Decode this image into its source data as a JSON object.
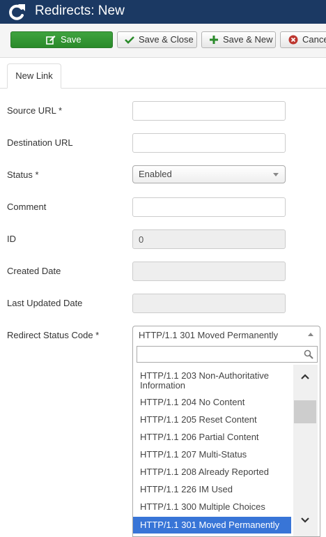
{
  "header": {
    "title": "Redirects: New"
  },
  "toolbar": {
    "save": "Save",
    "save_close": "Save & Close",
    "save_new": "Save & New",
    "cancel": "Cancel"
  },
  "tabs": [
    {
      "label": "New Link"
    }
  ],
  "form": {
    "source_url": {
      "label": "Source URL *",
      "value": ""
    },
    "destination_url": {
      "label": "Destination URL",
      "value": ""
    },
    "status": {
      "label": "Status *",
      "value": "Enabled"
    },
    "comment": {
      "label": "Comment",
      "value": ""
    },
    "id": {
      "label": "ID",
      "value": "0"
    },
    "created_date": {
      "label": "Created Date",
      "value": ""
    },
    "last_updated_date": {
      "label": "Last Updated Date",
      "value": ""
    },
    "redirect_status_code": {
      "label": "Redirect Status Code *",
      "value": "HTTP/1.1 301 Moved Permanently",
      "search_value": "",
      "options": [
        "HTTP/1.1 203 Non-Authoritative Information",
        "HTTP/1.1 204 No Content",
        "HTTP/1.1 205 Reset Content",
        "HTTP/1.1 206 Partial Content",
        "HTTP/1.1 207 Multi-Status",
        "HTTP/1.1 208 Already Reported",
        "HTTP/1.1 226 IM Used",
        "HTTP/1.1 300 Multiple Choices",
        "HTTP/1.1 301 Moved Permanently"
      ],
      "selected_option": "HTTP/1.1 301 Moved Permanently"
    }
  },
  "colors": {
    "header_bg": "#1b3963",
    "save_button": "#2f8f2f",
    "selected_option": "#3875d7"
  },
  "icons": {
    "header": "redo-arrow-icon",
    "save": "edit-icon",
    "save_close": "check-icon",
    "save_new": "plus-icon",
    "cancel": "cancel-circle-icon",
    "search": "search-icon",
    "scroll_up": "chevron-up-icon",
    "scroll_down": "chevron-down-icon"
  }
}
